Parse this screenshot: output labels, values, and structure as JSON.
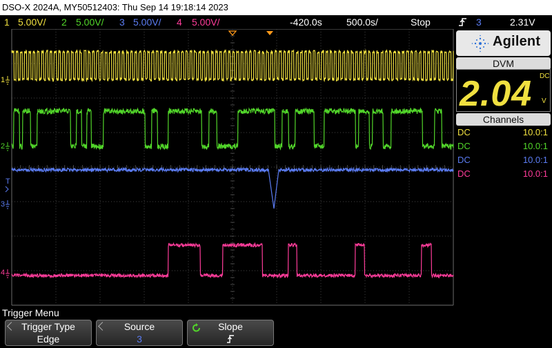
{
  "title": "DSO-X 2024A, MY50512403: Thu Sep 14 19:18:14 2023",
  "status": {
    "ch1_num": "1",
    "ch1_scale": "5.00V/",
    "ch2_num": "2",
    "ch2_scale": "5.00V/",
    "ch3_num": "3",
    "ch3_scale": "5.00V/",
    "ch4_num": "4",
    "ch4_scale": "5.00V/",
    "delay": "-420.0s",
    "timebase": "500.0s/",
    "run_state": "Stop",
    "trigger_slope_icon": "rising-edge-icon",
    "trigger_source": "3",
    "trigger_level": "2.31V"
  },
  "brand": "Agilent",
  "dvm": {
    "header": "DVM",
    "reading": "2.04",
    "mode": "DC",
    "unit": "V"
  },
  "channels": {
    "header": "Channels",
    "rows": [
      {
        "coupling": "DC",
        "probe": "10.0:1",
        "color": "#f0e040"
      },
      {
        "coupling": "DC",
        "probe": "10.0:1",
        "color": "#52d62a"
      },
      {
        "coupling": "DC",
        "probe": "10.0:1",
        "color": "#5b7cf2"
      },
      {
        "coupling": "DC",
        "probe": "10.0:1",
        "color": "#ff3c9a"
      }
    ]
  },
  "trace_labels": {
    "ch1": "1",
    "ch2": "2",
    "ch3": "3",
    "ch4": "4",
    "trig": "T"
  },
  "menu": {
    "title": "Trigger Menu",
    "keys": [
      {
        "label": "Trigger Type",
        "value": "Edge"
      },
      {
        "label": "Source",
        "value": "3"
      },
      {
        "label": "Slope",
        "value": "rising-edge-icon"
      }
    ]
  },
  "colors": {
    "ch1": "#f0e040",
    "ch2": "#52d62a",
    "ch3": "#5b7cf2",
    "ch4": "#ff3c9a",
    "trigger_marker": "#ff9a1a",
    "grid": "#5a5a5a"
  }
}
